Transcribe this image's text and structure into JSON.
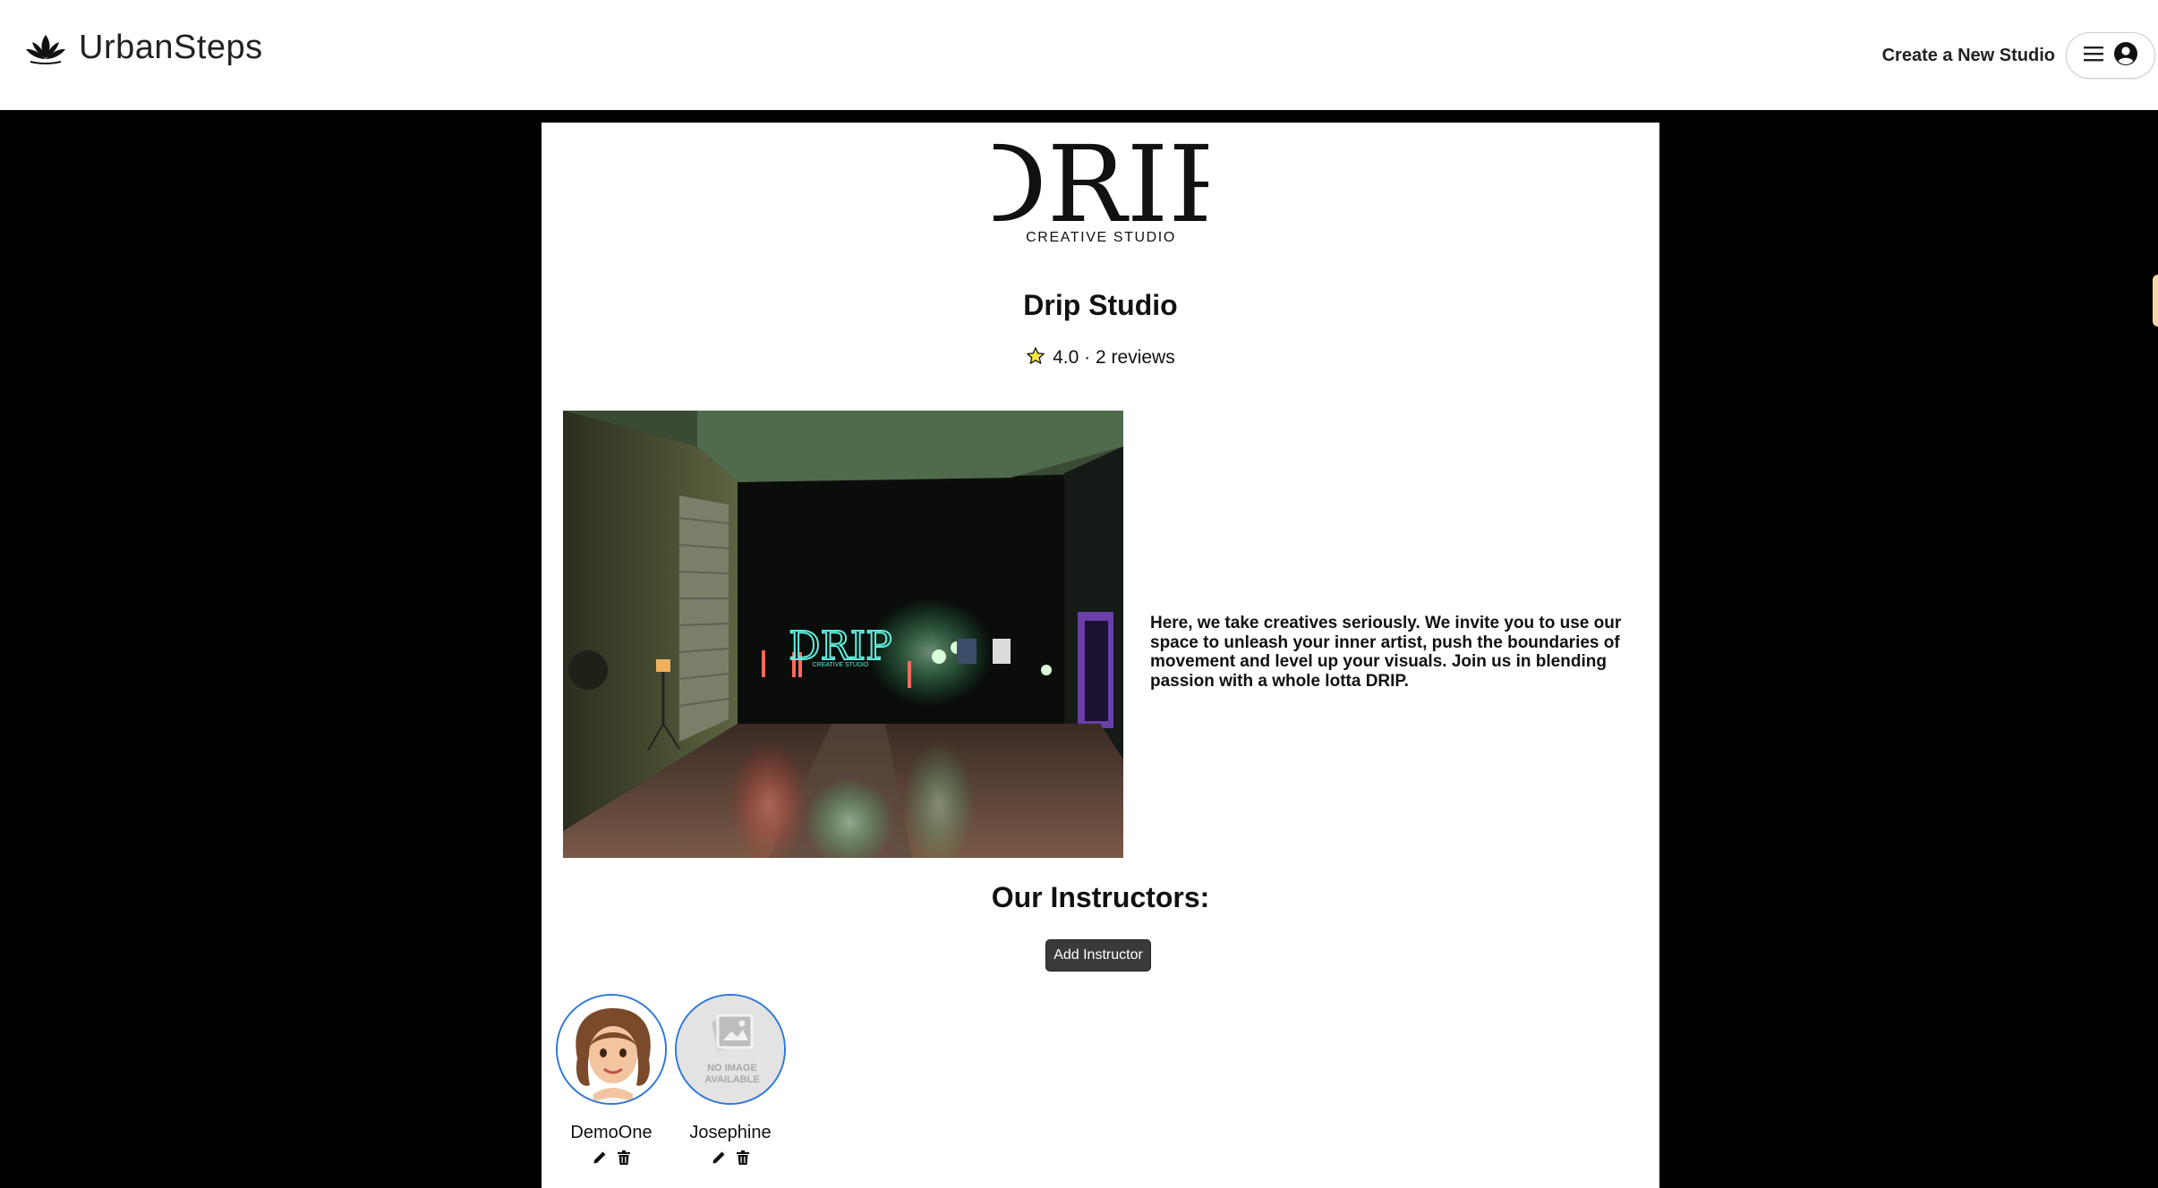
{
  "header": {
    "brand_name": "UrbanSteps",
    "create_studio_label": "Create a New Studio",
    "icons": [
      "lotus-logo-icon",
      "hamburger-menu-icon",
      "user-circle-icon"
    ]
  },
  "studio": {
    "logo_text": "DRIP",
    "logo_subtitle": "CREATIVE STUDIO",
    "name": "Drip Studio",
    "rating": "4.0",
    "separator": "·",
    "reviews": "2 reviews",
    "description": "Here, we take creatives seriously. We invite you to use our space to unleash your inner artist, push the boundaries of movement and level up your visuals. Join us in blending passion with a whole lotta DRIP.",
    "photo_sign_text": "DRIP",
    "photo_sign_subtitle": "CREATIVE STUDIO"
  },
  "instructors": {
    "heading": "Our Instructors:",
    "add_button_label": "Add Instructor",
    "no_image_text_line1": "NO IMAGE",
    "no_image_text_line2": "AVAILABLE",
    "items": [
      {
        "name": "DemoOne",
        "has_image": true
      },
      {
        "name": "Josephine",
        "has_image": false
      }
    ]
  },
  "colors": {
    "page_background": "#000000",
    "panel_background": "#ffffff",
    "avatar_ring": "#2e78d6",
    "button_background": "#3a3a3a",
    "star_fill": "#f5e642"
  }
}
